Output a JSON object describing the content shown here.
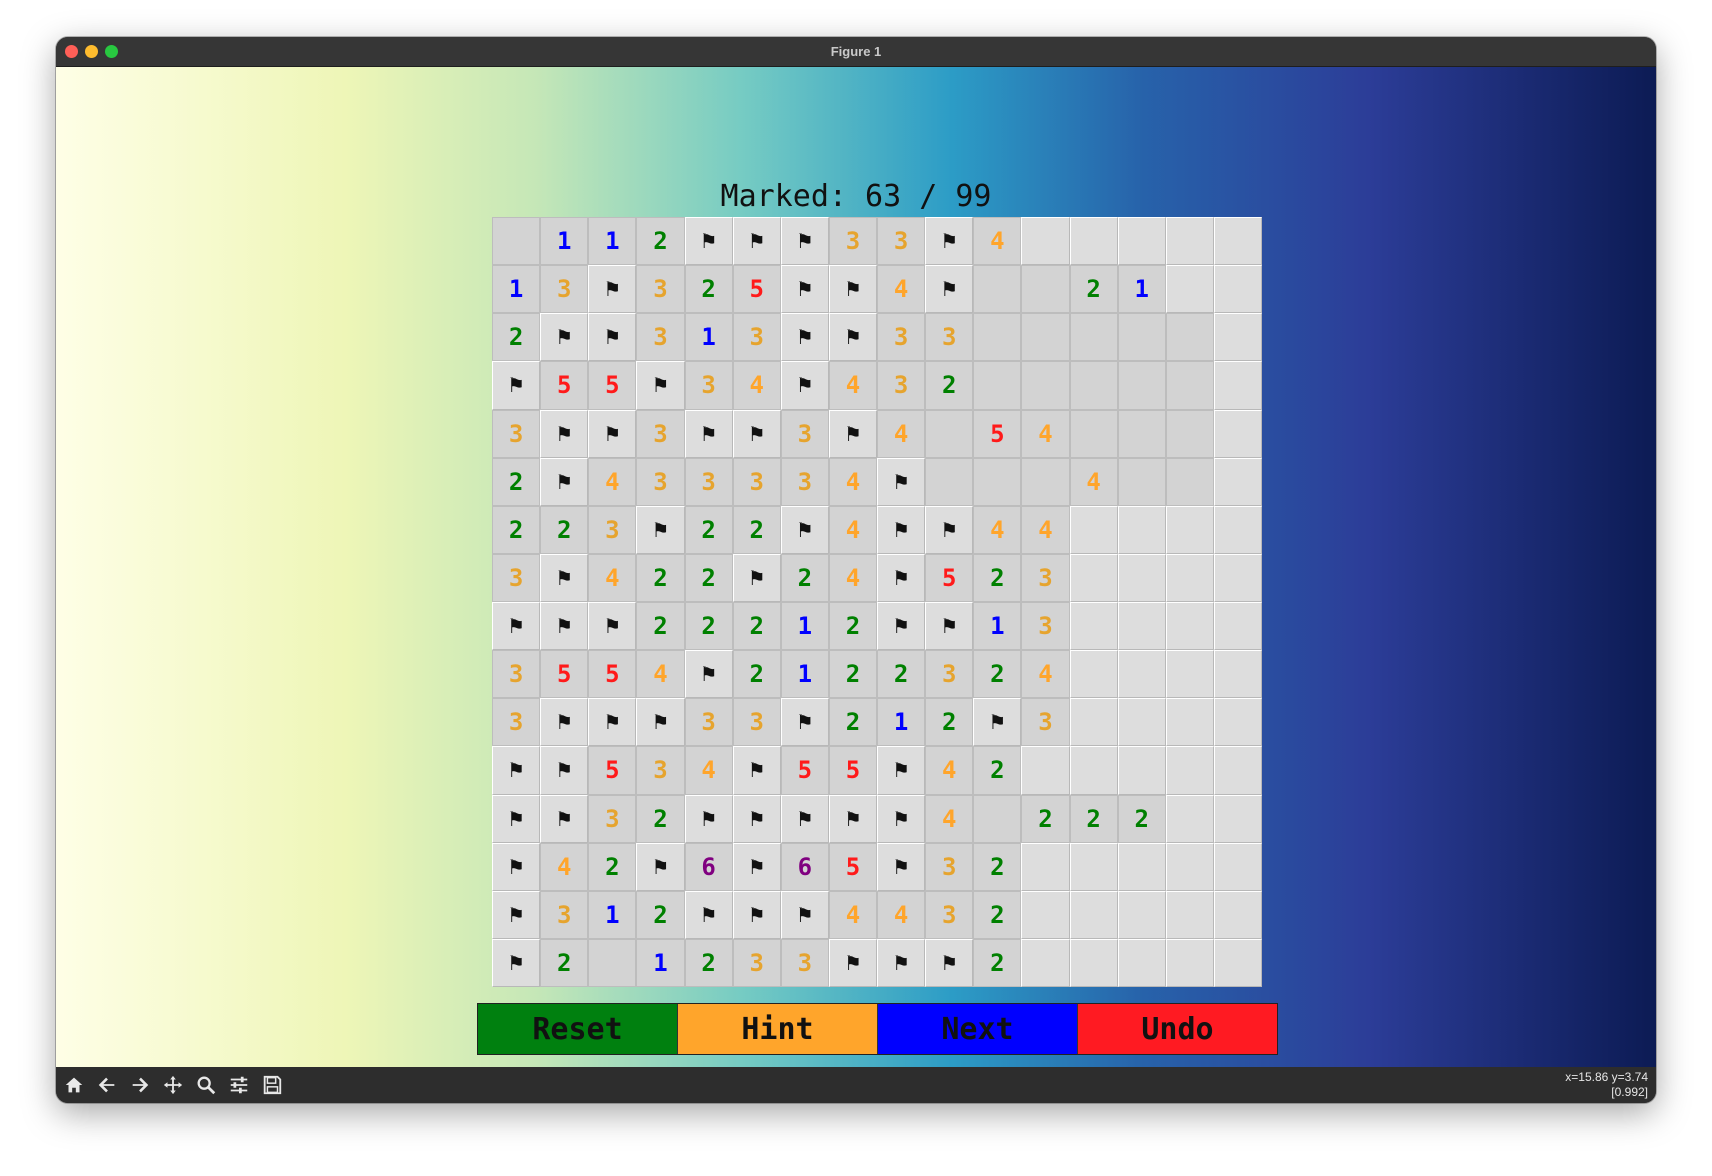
{
  "window": {
    "title": "Figure 1"
  },
  "status": {
    "marked_text": "Marked: 63 / 99"
  },
  "board": {
    "rows": [
      [
        " ",
        "1",
        "1",
        "2",
        "F",
        "F",
        "F",
        "3",
        "3",
        "F",
        "4",
        ".",
        ".",
        ".",
        ".",
        "."
      ],
      [
        "1",
        "3",
        "F",
        "3",
        "2",
        "5",
        "F",
        "F",
        "4",
        "F",
        " ",
        " ",
        "2",
        "1",
        ".",
        "."
      ],
      [
        "2",
        "F",
        "F",
        "3",
        "1",
        "3",
        "F",
        "F",
        "3",
        "3",
        " ",
        " ",
        " ",
        " ",
        " ",
        "."
      ],
      [
        "F",
        "5",
        "5",
        "F",
        "3",
        "4",
        "F",
        "4",
        "3",
        "2",
        " ",
        " ",
        " ",
        " ",
        " ",
        "."
      ],
      [
        "3",
        "F",
        "F",
        "3",
        "F",
        "F",
        "3",
        "F",
        "4",
        " ",
        "5",
        "4",
        " ",
        " ",
        " ",
        "."
      ],
      [
        "2",
        "F",
        "4",
        "3",
        "3",
        "3",
        "3",
        "4",
        "F",
        " ",
        " ",
        " ",
        "4",
        " ",
        " ",
        "."
      ],
      [
        "2",
        "2",
        "3",
        "F",
        "2",
        "2",
        "F",
        "4",
        "F",
        "F",
        "4",
        "4",
        ".",
        ".",
        ".",
        "."
      ],
      [
        "3",
        "F",
        "4",
        "2",
        "2",
        "F",
        "2",
        "4",
        "F",
        "5",
        "2",
        "3",
        ".",
        ".",
        ".",
        "."
      ],
      [
        "F",
        "F",
        "F",
        "2",
        "2",
        "2",
        "1",
        "2",
        "F",
        "F",
        "1",
        "3",
        ".",
        ".",
        ".",
        "."
      ],
      [
        "3",
        "5",
        "5",
        "4",
        "F",
        "2",
        "1",
        "2",
        "2",
        "3",
        "2",
        "4",
        ".",
        ".",
        ".",
        "."
      ],
      [
        "3",
        "F",
        "F",
        "F",
        "3",
        "3",
        "F",
        "2",
        "1",
        "2",
        "F",
        "3",
        ".",
        ".",
        ".",
        "."
      ],
      [
        "F",
        "F",
        "5",
        "3",
        "4",
        "F",
        "5",
        "5",
        "F",
        "4",
        "2",
        ".",
        ".",
        ".",
        ".",
        "."
      ],
      [
        "F",
        "F",
        "3",
        "2",
        "F",
        "F",
        "F",
        "F",
        "F",
        "4",
        " ",
        "2",
        "2",
        "2",
        ".",
        "."
      ],
      [
        "F",
        "4",
        "2",
        "F",
        "6",
        "F",
        "6",
        "5",
        "F",
        "3",
        "2",
        ".",
        ".",
        ".",
        ".",
        "."
      ],
      [
        "F",
        "3",
        "1",
        "2",
        "F",
        "F",
        "F",
        "4",
        "4",
        "3",
        "2",
        ".",
        ".",
        ".",
        ".",
        "."
      ],
      [
        "F",
        "2",
        " ",
        "1",
        "2",
        "3",
        "3",
        "F",
        "F",
        "F",
        "2",
        ".",
        ".",
        ".",
        ".",
        "."
      ]
    ],
    "flag_glyph": "⚑",
    "number_colors": {
      "1": "#0000ff",
      "2": "#008000",
      "3": "#e6a42e",
      "4": "#ffa52b",
      "5": "#ff1a1a",
      "6": "#800080"
    }
  },
  "buttons": [
    {
      "label": "Reset",
      "color": "#00800f"
    },
    {
      "label": "Hint",
      "color": "#ffa52b"
    },
    {
      "label": "Next",
      "color": "#0000ff"
    },
    {
      "label": "Undo",
      "color": "#ff1a22"
    }
  ],
  "toolbar": {
    "icons": [
      "home-icon",
      "back-arrow-icon",
      "forward-arrow-icon",
      "pan-icon",
      "zoom-icon",
      "configure-icon",
      "save-icon"
    ],
    "coords_line1": "x=15.86 y=3.74",
    "coords_line2": "[0.992]"
  }
}
